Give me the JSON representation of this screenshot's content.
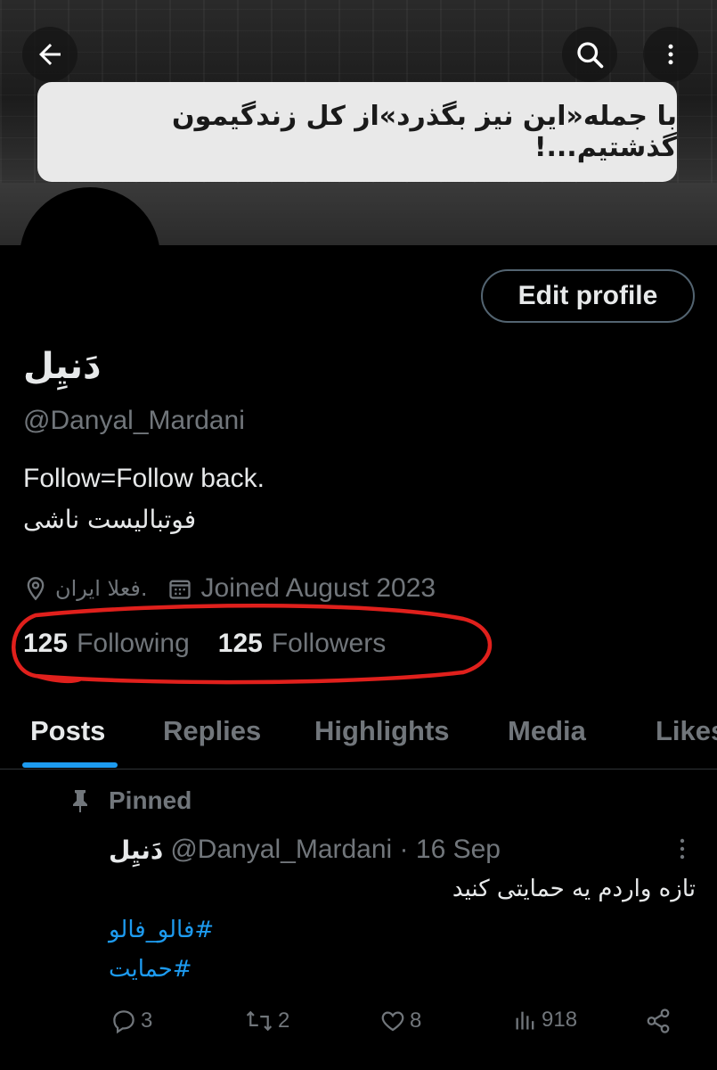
{
  "banner": {
    "quote": "با جمله«این نیز بگذرد»از کل زندگیمون گذشتیم...!"
  },
  "header": {
    "back_icon": "arrow-left-icon",
    "search_icon": "search-icon",
    "more_icon": "more-vertical-icon"
  },
  "profile": {
    "edit_button": "Edit profile",
    "name": "دَنیِل",
    "handle": "@Danyal_Mardani",
    "bio_line1": "Follow=Follow back.",
    "bio_line2": "فوتبالیست ناشی",
    "location": "فعلا ایران.",
    "joined": "Joined August 2023",
    "following_count": "125",
    "following_label": "Following",
    "followers_count": "125",
    "followers_label": "Followers"
  },
  "tabs": [
    "Posts",
    "Replies",
    "Highlights",
    "Media",
    "Likes"
  ],
  "post": {
    "pinned_label": "Pinned",
    "author_name": "دَنیِل",
    "author_handle": "@Danyal_Mardani · 16 Sep",
    "text": "تازه واردم یه حمایتی کنید",
    "tag1": "#فالو_فالو",
    "tag2": "#حمایت",
    "replies": "3",
    "reposts": "2",
    "likes": "8",
    "views": "918"
  },
  "colors": {
    "accent": "#1d9bf0",
    "muted": "#71767b",
    "annotation": "#e0201c"
  }
}
